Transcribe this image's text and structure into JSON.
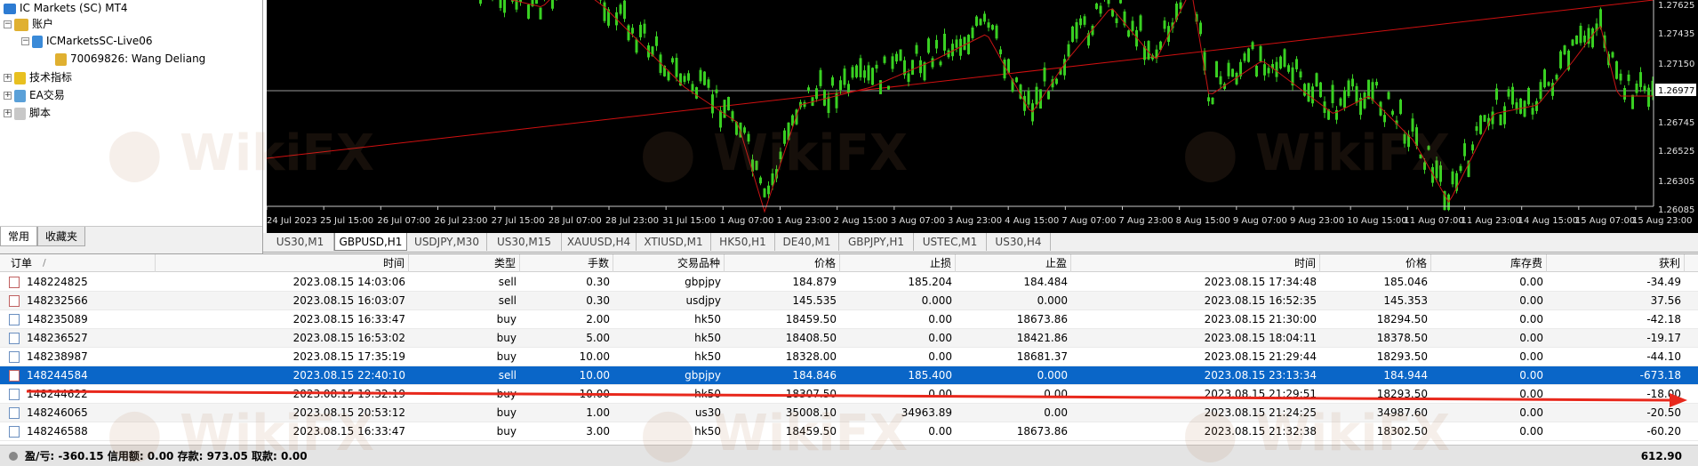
{
  "navigator": {
    "root": "IC Markets (SC) MT4",
    "accounts": "账户",
    "server": "ICMarketsSC-Live06",
    "account": "70069826: Wang Deliang",
    "indicators": "技术指标",
    "ea": "EA交易",
    "scripts": "脚本",
    "tab_common": "常用",
    "tab_favorites": "收藏夹"
  },
  "chart": {
    "price_labels": [
      "1.27625",
      "1.27435",
      "1.27150",
      "1.26977",
      "1.26745",
      "1.26525",
      "1.26305",
      "1.26085"
    ],
    "current_price": "1.26977",
    "time_labels": [
      "24 Jul 2023",
      "25 Jul 15:00",
      "26 Jul 07:00",
      "26 Jul 23:00",
      "27 Jul 15:00",
      "28 Jul 07:00",
      "28 Jul 23:00",
      "31 Jul 15:00",
      "1 Aug 07:00",
      "1 Aug 23:00",
      "2 Aug 15:00",
      "3 Aug 07:00",
      "3 Aug 23:00",
      "4 Aug 15:00",
      "7 Aug 07:00",
      "7 Aug 23:00",
      "8 Aug 15:00",
      "9 Aug 07:00",
      "9 Aug 23:00",
      "10 Aug 15:00",
      "11 Aug 07:00",
      "11 Aug 23:00",
      "14 Aug 15:00",
      "15 Aug 07:00",
      "15 Aug 23:00"
    ]
  },
  "chart_tabs": [
    "US30,M1",
    "GBPUSD,H1",
    "USDJPY,M30",
    "US30,M15",
    "XAUUSD,H4",
    "XTIUSD,M1",
    "HK50,H1",
    "DE40,M1",
    "GBPJPY,H1",
    "USTEC,M1",
    "US30,H4"
  ],
  "active_tab": "GBPUSD,H1",
  "table": {
    "headers": [
      "订单",
      "时间",
      "类型",
      "手数",
      "交易品种",
      "价格",
      "止损",
      "止盈",
      "时间",
      "价格",
      "库存费",
      "获利"
    ],
    "sort_mark": "/",
    "rows": [
      [
        "148224825",
        "2023.08.15 14:03:06",
        "sell",
        "0.30",
        "gbpjpy",
        "184.879",
        "185.204",
        "184.484",
        "2023.08.15 17:34:48",
        "185.046",
        "0.00",
        "-34.49"
      ],
      [
        "148232566",
        "2023.08.15 16:03:07",
        "sell",
        "0.30",
        "usdjpy",
        "145.535",
        "0.000",
        "0.000",
        "2023.08.15 16:52:35",
        "145.353",
        "0.00",
        "37.56"
      ],
      [
        "148235089",
        "2023.08.15 16:33:47",
        "buy",
        "2.00",
        "hk50",
        "18459.50",
        "0.00",
        "18673.86",
        "2023.08.15 21:30:00",
        "18294.50",
        "0.00",
        "-42.18"
      ],
      [
        "148236527",
        "2023.08.15 16:53:02",
        "buy",
        "5.00",
        "hk50",
        "18408.50",
        "0.00",
        "18421.86",
        "2023.08.15 18:04:11",
        "18378.50",
        "0.00",
        "-19.17"
      ],
      [
        "148238987",
        "2023.08.15 17:35:19",
        "buy",
        "10.00",
        "hk50",
        "18328.00",
        "0.00",
        "18681.37",
        "2023.08.15 21:29:44",
        "18293.50",
        "0.00",
        "-44.10"
      ],
      [
        "148244584",
        "2023.08.15 22:40:10",
        "sell",
        "10.00",
        "gbpjpy",
        "184.846",
        "185.400",
        "0.000",
        "2023.08.15 23:13:34",
        "184.944",
        "0.00",
        "-673.18"
      ],
      [
        "148244622",
        "2023.08.15 19:32:19",
        "buy",
        "10.00",
        "hk50",
        "18307.50",
        "0.00",
        "0.00",
        "2023.08.15 21:29:51",
        "18293.50",
        "0.00",
        "-18.00"
      ],
      [
        "148246065",
        "2023.08.15 20:53:12",
        "buy",
        "1.00",
        "us30",
        "35008.10",
        "34963.89",
        "0.00",
        "2023.08.15 21:24:25",
        "34987.60",
        "0.00",
        "-20.50"
      ],
      [
        "148246588",
        "2023.08.15 16:33:47",
        "buy",
        "3.00",
        "hk50",
        "18459.50",
        "0.00",
        "18673.86",
        "2023.08.15 21:32:38",
        "18302.50",
        "0.00",
        "-60.20"
      ]
    ],
    "selected_index": 5
  },
  "summary": {
    "text": "盈/亏: -360.15  信用额: 0.00  存款: 973.05  取款: 0.00",
    "total": "612.90"
  },
  "watermark": "WikiFX",
  "colors": {
    "bull": "#39d022",
    "ma": "#c81414",
    "trend": "#d01010",
    "selection": "#0a66c8",
    "arrow": "#e8281c"
  }
}
